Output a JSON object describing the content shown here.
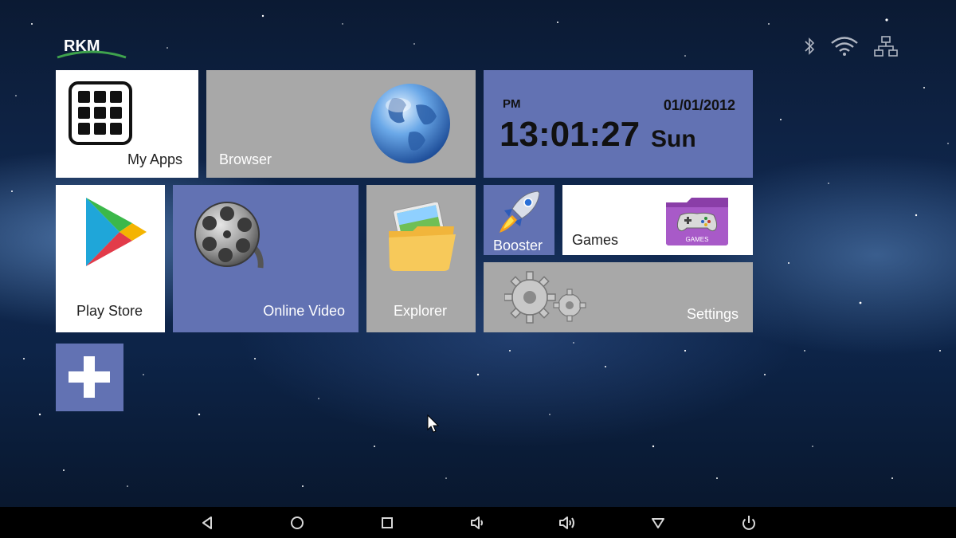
{
  "brand": {
    "logo_text": "RKM"
  },
  "status_bar": {
    "icons": [
      "bluetooth-icon",
      "wifi-icon",
      "ethernet-icon"
    ]
  },
  "tiles": {
    "my_apps": {
      "label": "My Apps",
      "icon": "app-grid-icon"
    },
    "browser": {
      "label": "Browser",
      "icon": "globe-icon"
    },
    "clock": {
      "ampm": "PM",
      "time": "13:01:27",
      "date": "01/01/2012",
      "day": "Sun"
    },
    "play_store": {
      "label": "Play Store",
      "icon": "play-store-icon"
    },
    "online_video": {
      "label": "Online Video",
      "icon": "film-reel-icon"
    },
    "explorer": {
      "label": "Explorer",
      "icon": "folder-icon"
    },
    "booster": {
      "label": "Booster",
      "icon": "rocket-icon"
    },
    "games": {
      "label": "Games",
      "icon": "games-folder-icon",
      "folder_text": "GAMES"
    },
    "settings": {
      "label": "Settings",
      "icon": "gears-icon"
    },
    "add": {
      "icon": "plus-icon"
    }
  },
  "navbar": {
    "buttons": [
      "back-icon",
      "home-icon",
      "recents-icon",
      "volume-down-icon",
      "volume-up-icon",
      "menu-down-icon",
      "power-icon"
    ]
  },
  "colors": {
    "tile_blue": "#6272b3",
    "tile_gray": "#a8a8a8",
    "tile_white": "#ffffff",
    "navbar": "#000000"
  }
}
